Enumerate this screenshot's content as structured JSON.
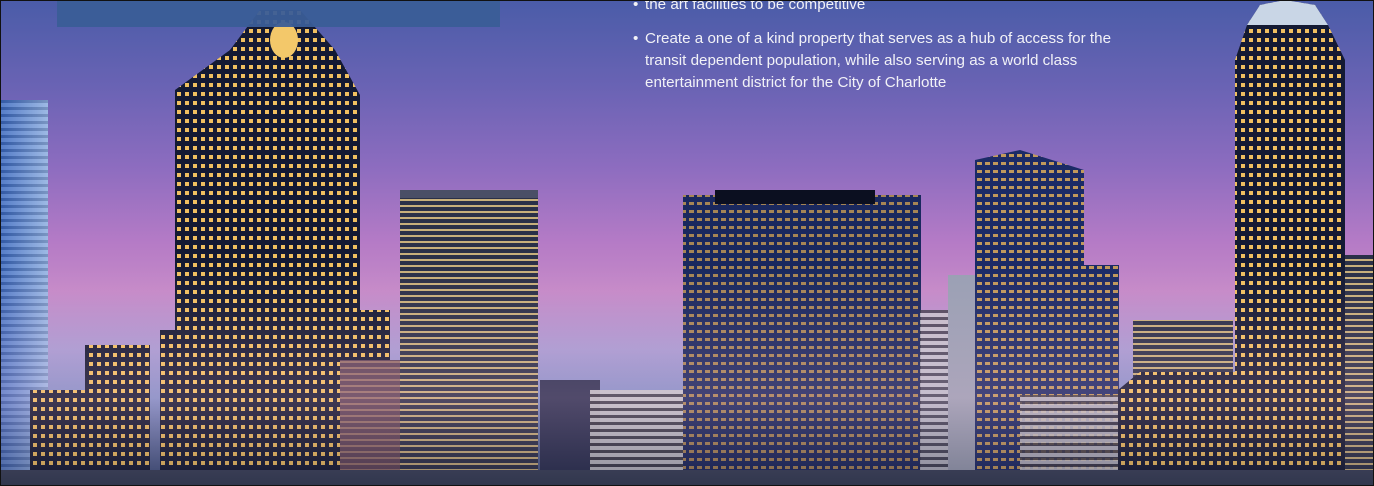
{
  "slide": {
    "bullets": [
      "the art facilities to be competitive",
      "Create a one of a kind property that serves as a hub of access for the transit dependent population, while also serving as a world class entertainment district for the City of Charlotte"
    ],
    "bullet_marker": "•",
    "title_band_color": "#3a5d97",
    "background": "city-skyline-photo"
  }
}
